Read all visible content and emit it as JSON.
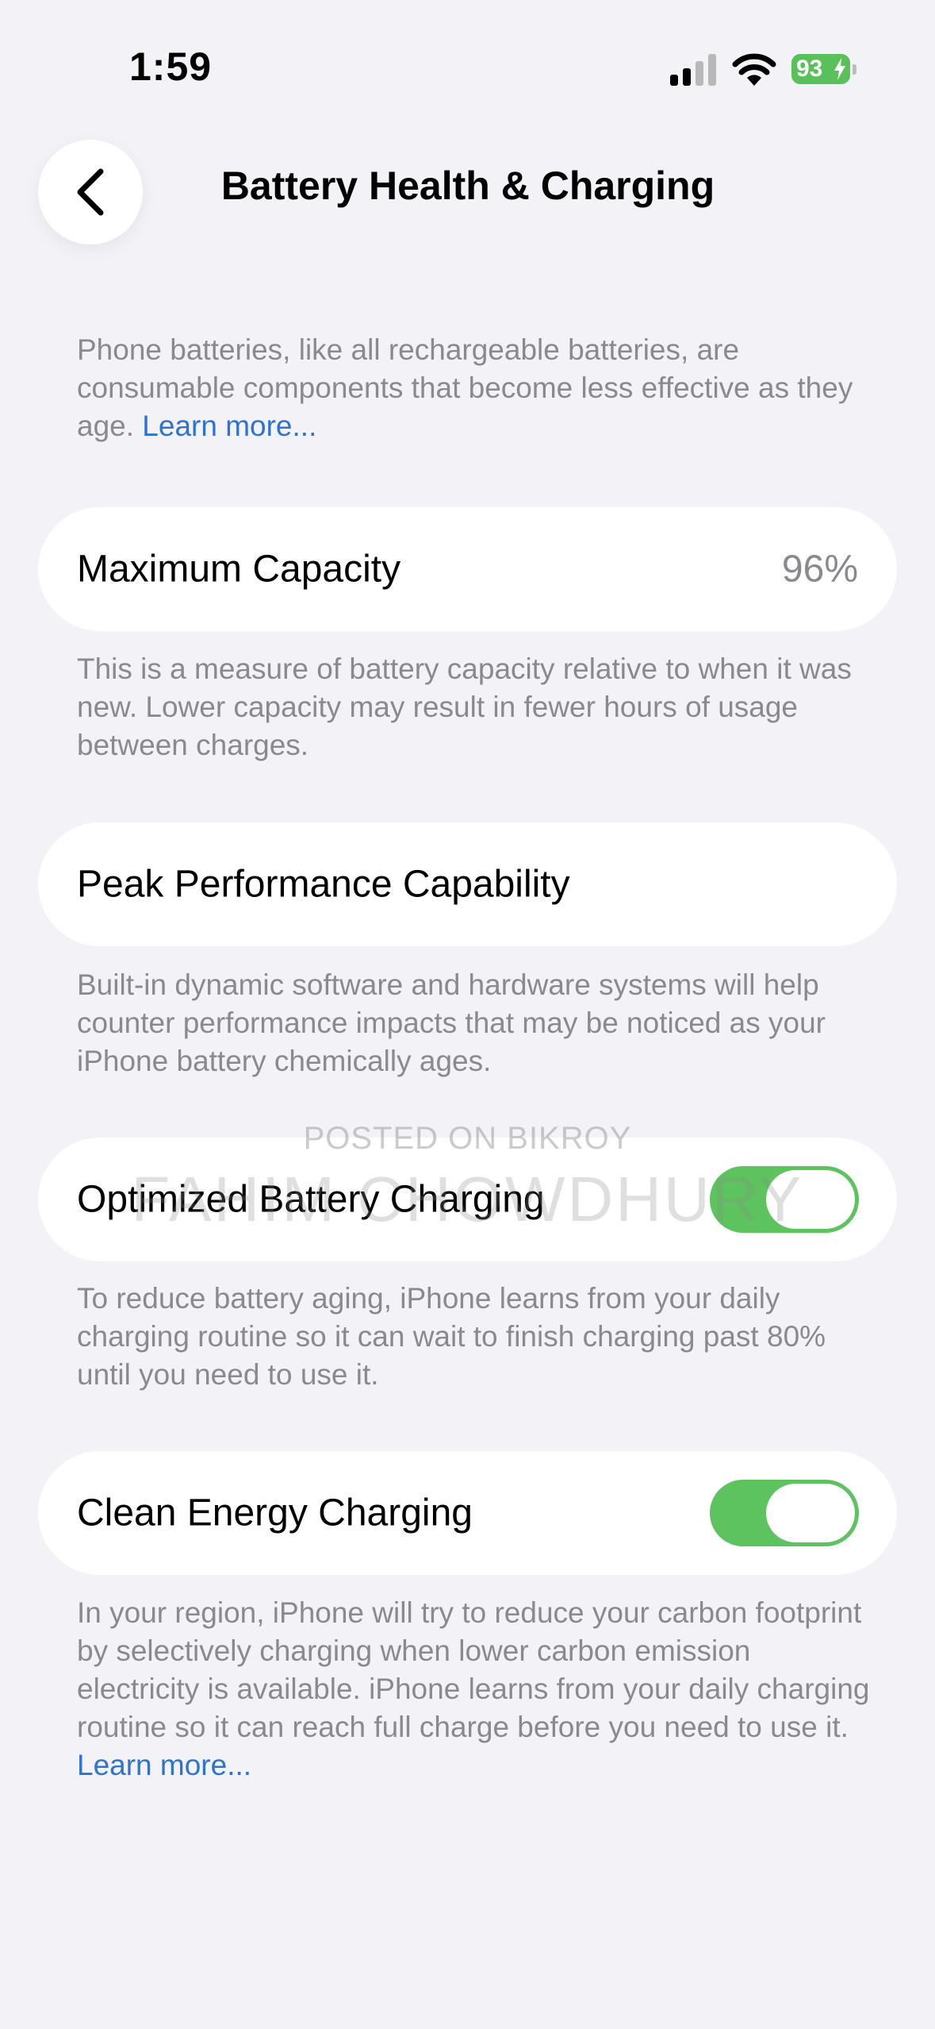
{
  "status_bar": {
    "time": "1:59",
    "battery_level": "93"
  },
  "nav": {
    "title": "Battery Health & Charging"
  },
  "intro": {
    "text": "Phone batteries, like all rechargeable batteries, are consumable components that become less effective as they age. ",
    "link": "Learn more..."
  },
  "max_capacity": {
    "label": "Maximum Capacity",
    "value": "96%",
    "description": "This is a measure of battery capacity relative to when it was new. Lower capacity may result in fewer hours of usage between charges."
  },
  "peak_performance": {
    "label": "Peak Performance Capability",
    "description": "Built-in dynamic software and hardware systems will help counter performance impacts that may be noticed as your iPhone battery chemically ages."
  },
  "optimized_charging": {
    "label": "Optimized Battery Charging",
    "enabled": true,
    "description": "To reduce battery aging, iPhone learns from your daily charging routine so it can wait to finish charging past 80% until you need to use it."
  },
  "clean_energy": {
    "label": "Clean Energy Charging",
    "enabled": true,
    "description": "In your region, iPhone will try to reduce your carbon footprint by selectively charging when lower carbon emission electricity is available. iPhone learns from your daily charging routine so it can reach full charge before you need to use it. ",
    "link": "Learn more..."
  },
  "watermark": {
    "line1": "POSTED ON BIKROY",
    "line2": "FAHIM CHOWDHURY"
  },
  "colors": {
    "background": "#f2f2f7",
    "toggle_on": "#5cc35e",
    "link": "#2f73d1",
    "battery": "#5ac05a"
  }
}
